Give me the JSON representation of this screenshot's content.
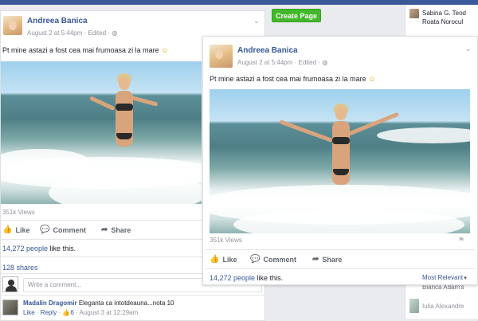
{
  "post_back": {
    "author": "Andreea Banica",
    "timestamp": "August 2 at 5:44pm · Edited · ",
    "globe_icon": "globe-icon",
    "text": "Pt mine astazi a fost cea mai frumoasa zi la mare",
    "emoji": "☺",
    "views": "351k Views",
    "actions": {
      "like": "Like",
      "comment": "Comment",
      "share": "Share"
    },
    "likes_count": "14,272 people",
    "likes_suffix": " like this.",
    "shares": "128 shares",
    "comment_placeholder": "Write a comment...",
    "comment": {
      "author": "Madalin Dragomir",
      "text": "Eleganta ca intotdeauna...nota 10",
      "like": "Like",
      "reply": "Reply",
      "reactions": "6",
      "time": "August 3 at 12:29am"
    }
  },
  "post_front": {
    "author": "Andreea Banica",
    "timestamp": "August 2 at 5:44pm · Edited · ",
    "text": "Pt mine astazi a fost cea mai frumoasa zi la mare",
    "emoji": "☺",
    "views": "351k Views",
    "actions": {
      "like": "Like",
      "comment": "Comment",
      "share": "Share"
    },
    "likes_count": "14,272 people",
    "likes_suffix": " like this.",
    "most_relevant": "Most Relevant"
  },
  "sidebar": {
    "create_page": "Create Page"
  },
  "chat": [
    {
      "line1": "Sabina G. Teod",
      "line2": "Roata Norocul"
    },
    {
      "line1": "Bianca Adam's",
      "line2": ""
    },
    {
      "line1": "Iulia Alexandre",
      "line2": ""
    }
  ],
  "colors": {
    "facebook_blue": "#3b5998",
    "link": "#365899",
    "green": "#42b72a"
  }
}
